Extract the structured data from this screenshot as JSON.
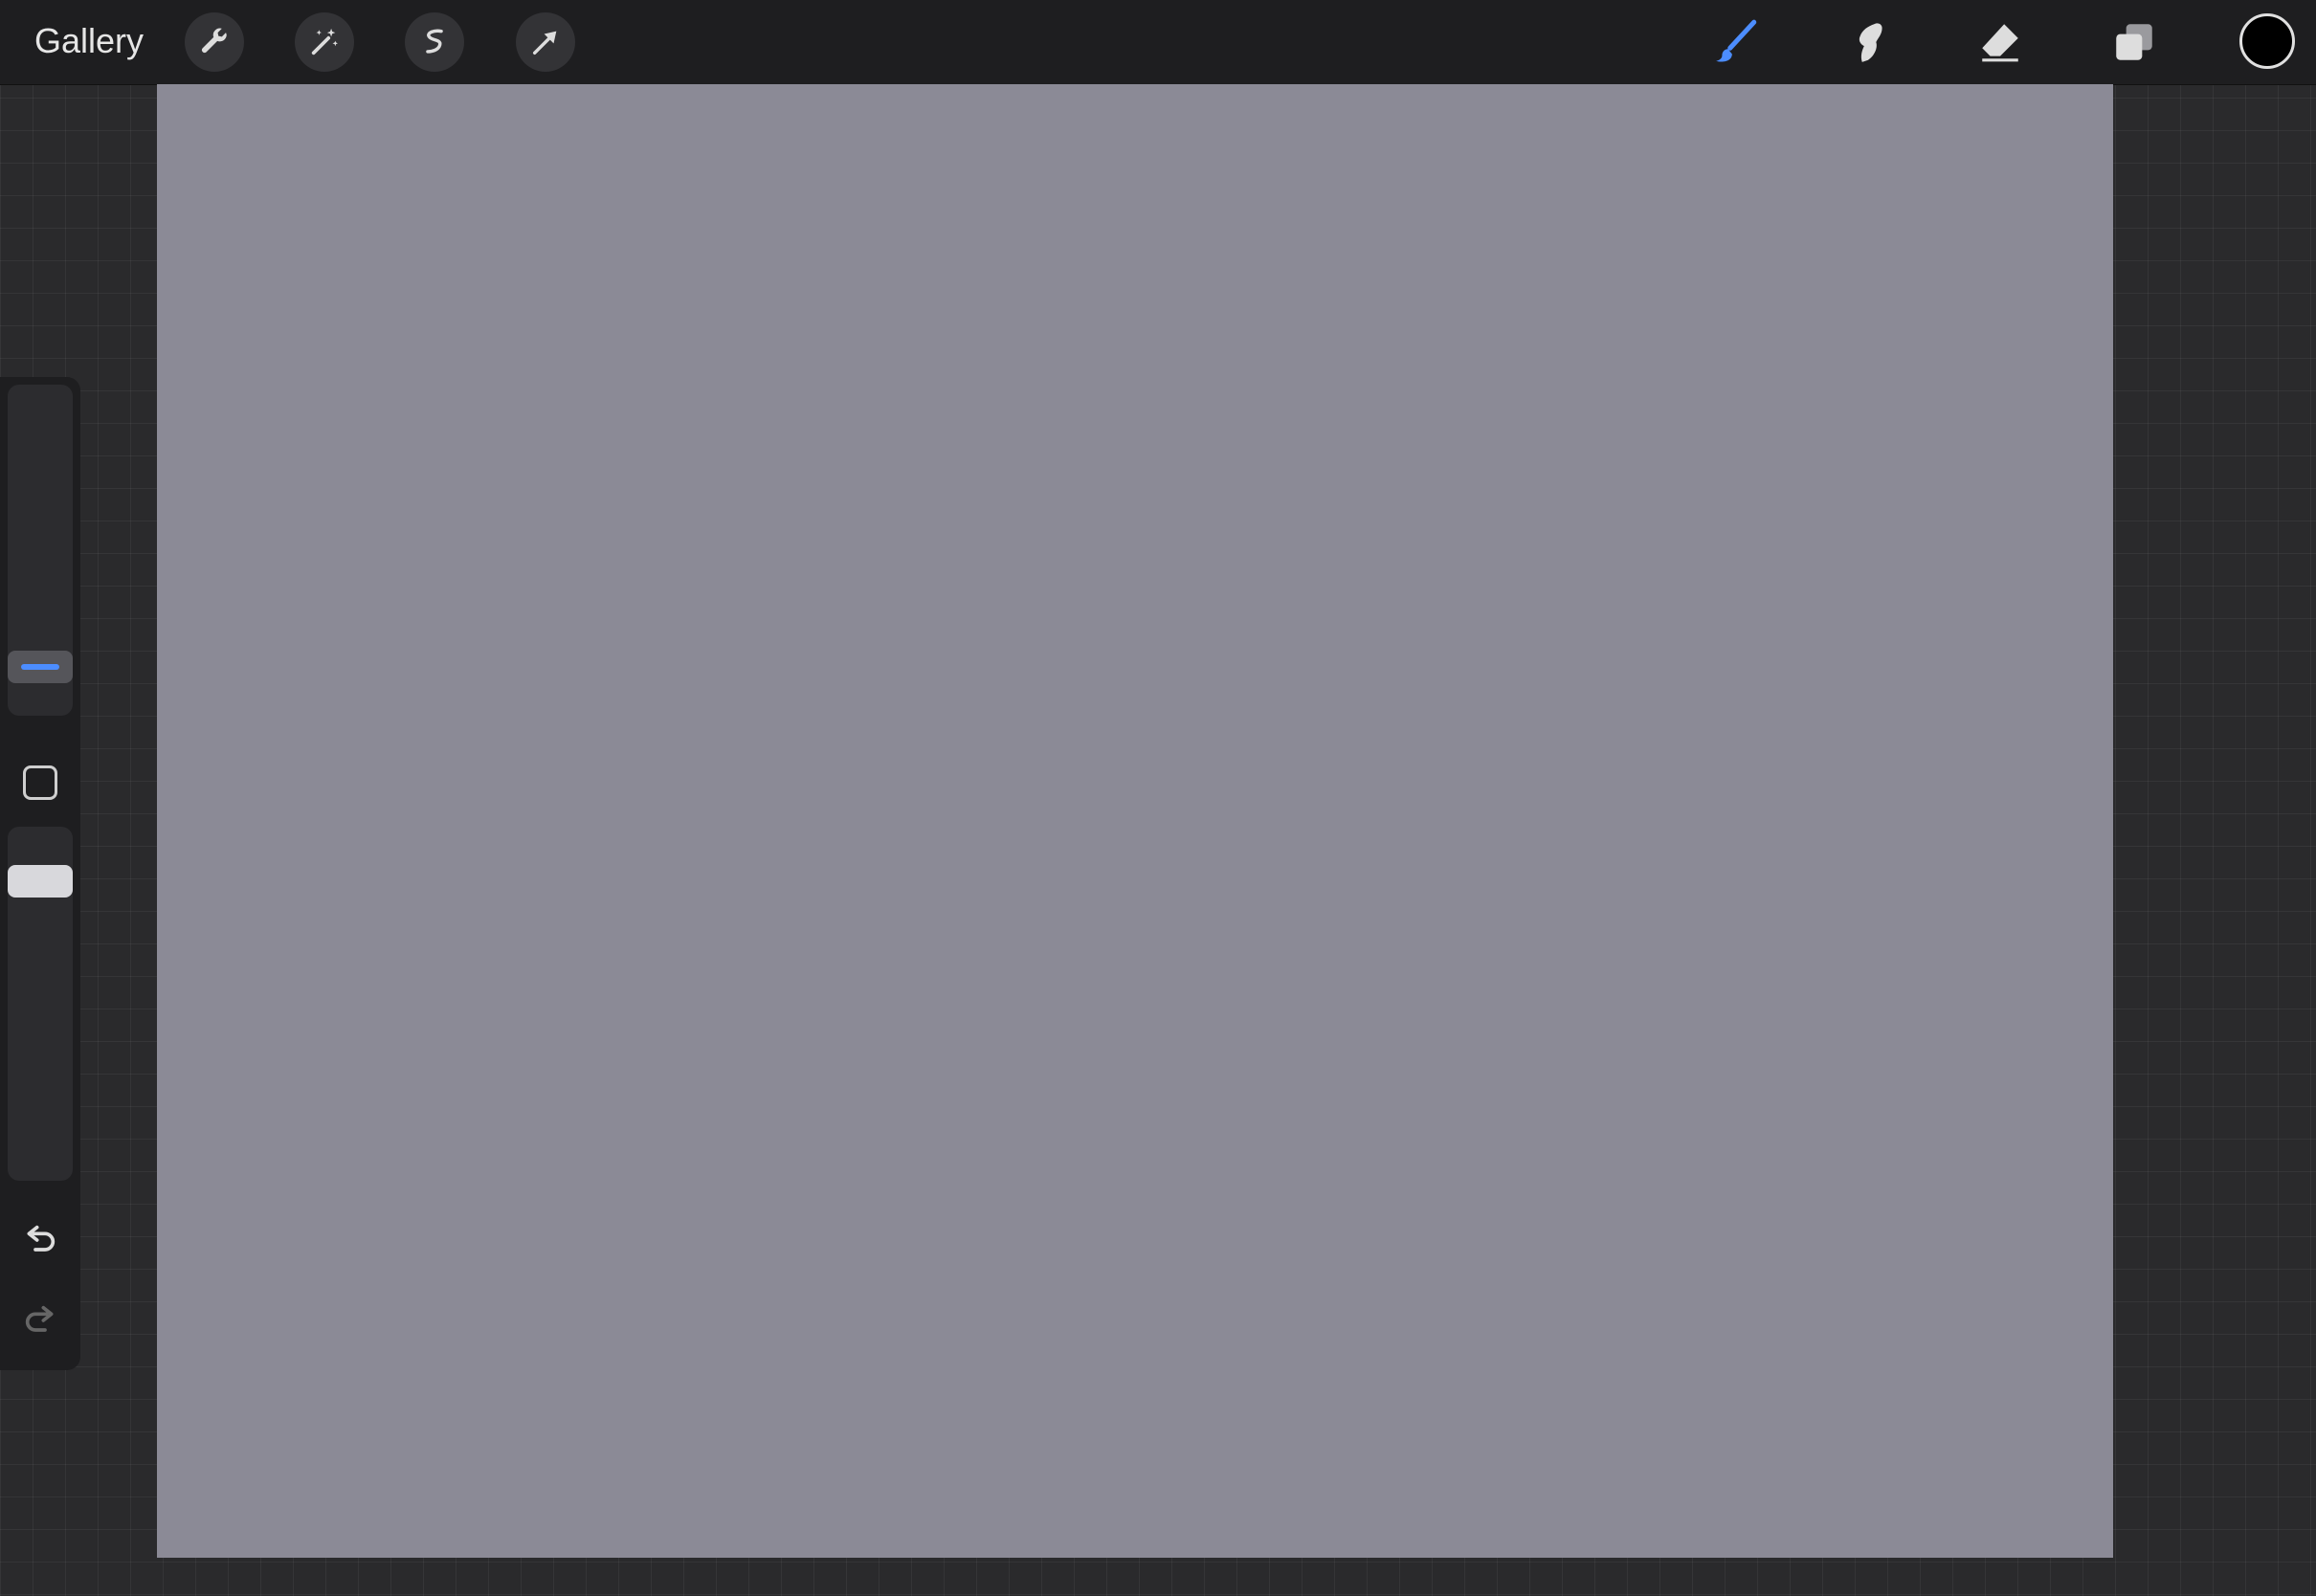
{
  "topbar": {
    "gallery_label": "Gallery",
    "left_tools": [
      "wrench-icon",
      "magic-wand-icon",
      "selection-icon",
      "transform-arrow-icon"
    ],
    "right_tools": [
      "brush-icon",
      "smudge-icon",
      "eraser-icon",
      "layers-icon"
    ],
    "active_tool": "brush-icon",
    "current_color": "#000000",
    "accent_color": "#4c8dff"
  },
  "sidebar": {
    "controls": [
      "brush-size-slider",
      "modify-button",
      "opacity-slider",
      "undo-icon",
      "redo-icon"
    ]
  },
  "canvas": {
    "background_color": "#8b8a96"
  }
}
